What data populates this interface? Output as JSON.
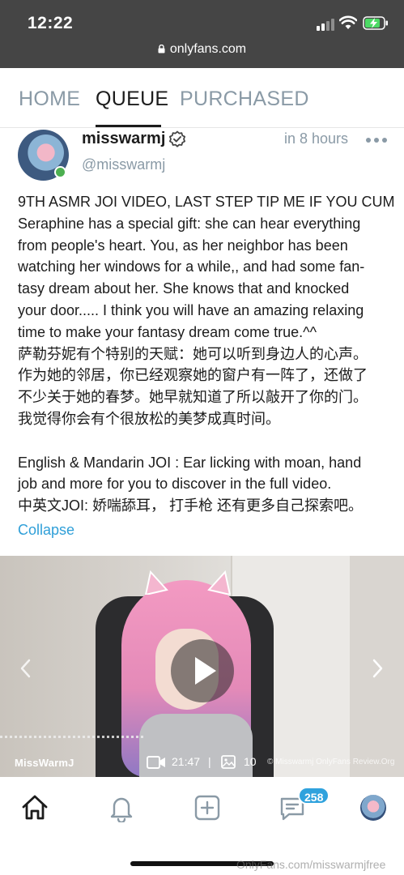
{
  "status_bar": {
    "time": "12:22",
    "url": "onlyfans.com"
  },
  "tabs": [
    {
      "label": "HOME",
      "active": false
    },
    {
      "label": "QUEUE",
      "active": true
    },
    {
      "label": "PURCHASED",
      "active": false
    }
  ],
  "post": {
    "username": "misswarmj",
    "handle": "@misswarmj",
    "time": "in 8 hours",
    "text_lines": [
      "9TH ASMR JOI VIDEO, LAST STEP TIP ME IF YOU CUM",
      "Seraphine has a special gift: she can hear everything",
      "from people's heart. You, as her neighbor has been",
      "watching her windows for a while,, and had some fan-",
      "tasy dream about her. She knows that and knocked",
      "your door..... I think you will have an amazing relaxing",
      "time to make your fantasy dream come true.^^",
      "萨勒芬妮有个特别的天赋：她可以听到身边人的心声。",
      "作为她的邻居，你已经观察她的窗户有一阵了，还做了",
      "不少关于她的春梦。她早就知道了所以敲开了你的门。",
      "我觉得你会有个很放松的美梦成真时间。",
      "",
      "English & Mandarin JOI : Ear licking with moan, hand",
      "job and more for you to discover in the full video.",
      "中英文JOI: 娇喘舔耳， 打手枪 还有更多自己探索吧。"
    ],
    "collapse_label": "Collapse",
    "media": {
      "brand_text": "MissWarmJ",
      "duration": "21:47",
      "separator": "|",
      "image_count": "10",
      "watermark": "© Misswarmj OnlyFans Review.Org"
    }
  },
  "bottom_nav": {
    "items": [
      "home-icon",
      "bell-icon",
      "plus-square-icon",
      "message-icon",
      "avatar"
    ],
    "messages_badge": "258",
    "watermark": "OnlyFans.com/misswarmjfree"
  },
  "colors": {
    "accent": "#2fa2dd",
    "muted": "#8a9aa6",
    "online": "#4caf50"
  }
}
